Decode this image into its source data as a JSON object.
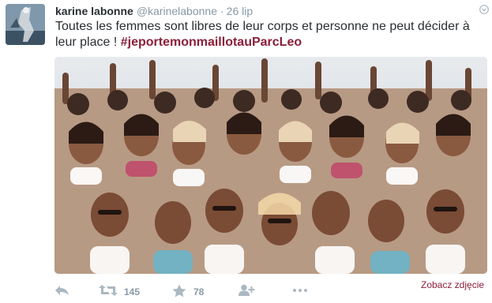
{
  "tweet": {
    "fullname": "karine labonne",
    "username": "@karinelabonne",
    "separator": "·",
    "time": "26 lip",
    "text": "Toutes les femmes sont libres de leur corps et personne ne peut décider à leur place ! ",
    "hashtag": "#jeportemonmaillotauParcLeo",
    "view_photo_label": "Zobacz zdjęcie",
    "actions": {
      "reply_icon": "reply-icon",
      "retweet_icon": "retweet-icon",
      "retweet_count": "145",
      "favorite_icon": "star-icon",
      "favorite_count": "78",
      "follow_icon": "follow-icon",
      "more_icon": "more-icon"
    },
    "colors": {
      "link": "#8c1f3a",
      "muted": "#8899a6",
      "text": "#292f33"
    }
  }
}
